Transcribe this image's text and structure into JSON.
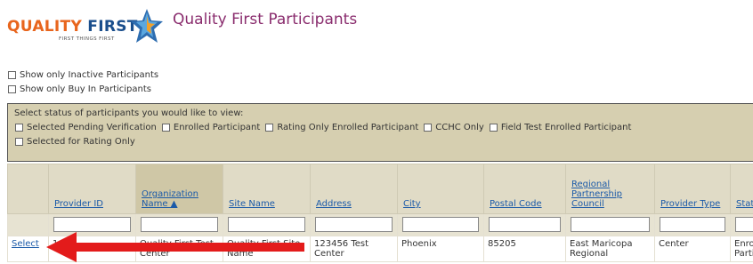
{
  "header": {
    "logo_main_a": "QUALITY",
    "logo_main_b": "FIRST",
    "logo_sub": "FIRST THINGS FIRST",
    "page_title": "Quality First Participants"
  },
  "checkboxes": [
    {
      "label": "Show only Inactive Participants"
    },
    {
      "label": "Show only Buy In Participants"
    }
  ],
  "status_filter": {
    "label": "Select status of participants you would like to view:",
    "options": [
      "Selected Pending Verification",
      "Enrolled Participant",
      "Rating Only Enrolled Participant",
      "CCHC Only",
      "Field Test Enrolled Participant",
      "Selected for Rating Only"
    ]
  },
  "table": {
    "columns": [
      "",
      "Provider ID",
      "Organization Name ▲",
      "Site Name",
      "Address",
      "City",
      "Postal Code",
      "Regional Partnership Council",
      "Provider Type",
      "Stat"
    ],
    "row": {
      "action": "Select",
      "provider_id": "1",
      "organization": "Quality First Test Center",
      "site": "Quality First Site Name",
      "address": "123456 Test Center",
      "city": "Phoenix",
      "postal": "85205",
      "council": "East Maricopa Regional",
      "type": "Center",
      "status": "Enrolled Partic"
    }
  },
  "colors": {
    "title": "#8a2d6e",
    "link": "#1b5aa8",
    "filter_bg": "#d6cfb0",
    "header_bg": "#e0dbc6",
    "arrow": "#e31b1b"
  },
  "annotation": {
    "icon": "red-arrow-icon"
  }
}
